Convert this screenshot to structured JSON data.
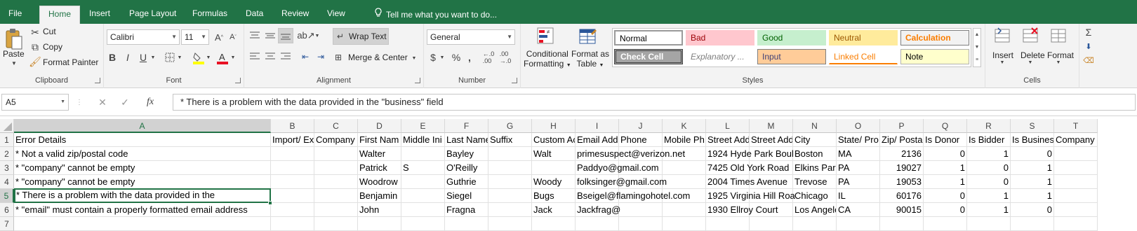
{
  "tabs": [
    {
      "label": "File",
      "active": false
    },
    {
      "label": "Home",
      "active": true
    },
    {
      "label": "Insert",
      "active": false
    },
    {
      "label": "Page Layout",
      "active": false
    },
    {
      "label": "Formulas",
      "active": false
    },
    {
      "label": "Data",
      "active": false
    },
    {
      "label": "Review",
      "active": false
    },
    {
      "label": "View",
      "active": false
    }
  ],
  "tell_me": "Tell me what you want to do...",
  "ribbon": {
    "clipboard": {
      "label": "Clipboard",
      "paste": "Paste",
      "cut": "Cut",
      "copy": "Copy",
      "format_painter": "Format Painter"
    },
    "font": {
      "label": "Font",
      "name": "Calibri",
      "size": "11",
      "bold": "B",
      "italic": "I",
      "underline": "U"
    },
    "alignment": {
      "label": "Alignment",
      "wrap_text": "Wrap Text",
      "merge_center": "Merge & Center"
    },
    "number": {
      "label": "Number",
      "format": "General",
      "currency": "$",
      "percent": "%",
      "comma": ","
    },
    "styles": {
      "label": "Styles",
      "conditional_formatting": [
        "Conditional",
        "Formatting"
      ],
      "format_as_table": [
        "Format as",
        "Table"
      ],
      "cells": [
        {
          "label": "Normal",
          "fg": "#000000",
          "bg": "#ffffff"
        },
        {
          "label": "Bad",
          "fg": "#9c0006",
          "bg": "#ffc7ce"
        },
        {
          "label": "Good",
          "fg": "#006100",
          "bg": "#c6efce"
        },
        {
          "label": "Neutral",
          "fg": "#9c5700",
          "bg": "#ffeb9c"
        },
        {
          "label": "Calculation",
          "fg": "#fa7d00",
          "bg": "#f2f2f2"
        },
        {
          "label": "Check Cell",
          "fg": "#ffffff",
          "bg": "#a5a5a5"
        },
        {
          "label": "Explanatory ...",
          "fg": "#7f7f7f",
          "bg": "#ffffff"
        },
        {
          "label": "Input",
          "fg": "#3f3f76",
          "bg": "#ffcc99"
        },
        {
          "label": "Linked Cell",
          "fg": "#fa7d00",
          "bg": "#ffffff"
        },
        {
          "label": "Note",
          "fg": "#000000",
          "bg": "#ffffcc"
        }
      ]
    },
    "cells": {
      "label": "Cells",
      "insert": "Insert",
      "delete": "Delete",
      "format": "Format"
    }
  },
  "formula_bar": {
    "name_box": "A5",
    "fx": "fx",
    "content": "* There is a problem with the data provided in the \"business\" field"
  },
  "grid": {
    "columns": [
      "A",
      "B",
      "C",
      "D",
      "E",
      "F",
      "G",
      "H",
      "I",
      "J",
      "K",
      "L",
      "M",
      "N",
      "O",
      "P",
      "Q",
      "R",
      "S",
      "T"
    ],
    "rows": [
      "1",
      "2",
      "3",
      "4",
      "5",
      "6",
      "7"
    ],
    "data": [
      [
        "Error Details",
        "Import/ Ex",
        "Company",
        "First Nam",
        "Middle Ini",
        "Last Name",
        "Suffix",
        "Custom Ac",
        "Email Add",
        "Phone",
        "Mobile Ph",
        "Street Add",
        "Street Add",
        "City",
        "State/ Pro",
        "Zip/ Posta",
        "Is Donor",
        "Is Bidder",
        "Is Busines",
        "Company"
      ],
      [
        "* Not a valid zip/postal code",
        "",
        "",
        "Walter",
        "",
        "Bayley",
        "",
        "Walt",
        "primesuspect@verizon.net",
        "",
        "",
        "1924 Hyde Park Boul",
        "",
        "Boston",
        "MA",
        "2136",
        "0",
        "1",
        "0",
        ""
      ],
      [
        "* \"company\" cannot be empty",
        "",
        "",
        "Patrick",
        "S",
        "O'Reilly",
        "",
        "",
        "Paddyo@gmail.com",
        "",
        "",
        "7425 Old York Road",
        "",
        "Elkins Parl",
        "PA",
        "19027",
        "1",
        "0",
        "1",
        ""
      ],
      [
        "* \"company\" cannot be empty",
        "",
        "",
        "Woodrow",
        "",
        "Guthrie",
        "",
        "Woody",
        "folksinger@gmail.com",
        "",
        "",
        "2004 Times Avenue",
        "",
        "Trevose",
        "PA",
        "19053",
        "1",
        "0",
        "1",
        ""
      ],
      [
        "* There is a problem with the data provided in the",
        "",
        "",
        "Benjamin",
        "",
        "Siegel",
        "",
        "Bugs",
        "Bseigel@flamingohotel.com",
        "",
        "",
        "1925 Virginia Hill Roa",
        "",
        "Chicago",
        "IL",
        "60176",
        "0",
        "1",
        "1",
        ""
      ],
      [
        "* \"email\" must contain a properly formatted email address",
        "",
        "",
        "John",
        "",
        "Fragna",
        "",
        "Jack",
        "Jackfrag@",
        "",
        "",
        "1930 Ellroy Court",
        "",
        "Los Angele",
        "CA",
        "90015",
        "0",
        "1",
        "0",
        ""
      ],
      [
        "",
        "",
        "",
        "",
        "",
        "",
        "",
        "",
        "",
        "",
        "",
        "",
        "",
        "",
        "",
        "",
        "",
        "",
        "",
        ""
      ]
    ],
    "active_cell": "A5"
  }
}
